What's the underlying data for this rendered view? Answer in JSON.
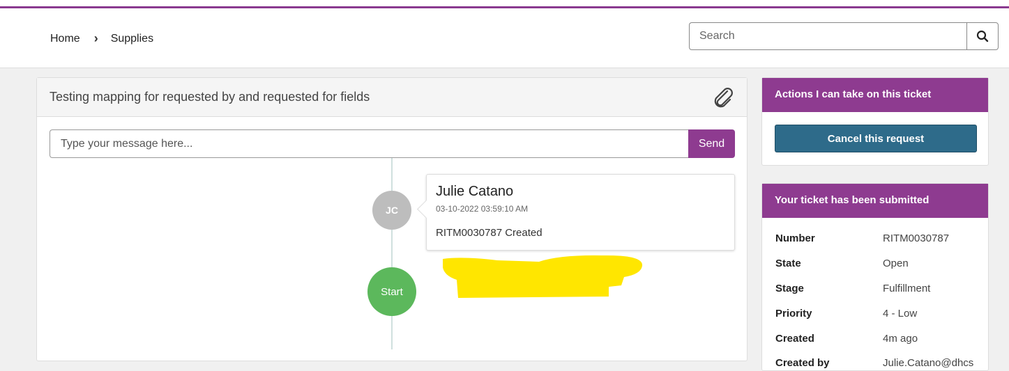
{
  "breadcrumb": {
    "home": "Home",
    "current": "Supplies"
  },
  "search": {
    "placeholder": "Search"
  },
  "ticket_panel": {
    "title": "Testing mapping for requested by and requested for fields",
    "message_placeholder": "Type your message here...",
    "send_label": "Send"
  },
  "activity": {
    "avatar_initials": "JC",
    "author": "Julie Catano",
    "timestamp": "03-10-2022 03:59:10 AM",
    "text": "RITM0030787 Created",
    "start_label": "Start"
  },
  "actions_panel": {
    "title": "Actions I can take on this ticket",
    "cancel_label": "Cancel this request"
  },
  "submitted_panel": {
    "title": "Your ticket has been submitted",
    "fields": [
      {
        "label": "Number",
        "value": "RITM0030787"
      },
      {
        "label": "State",
        "value": "Open"
      },
      {
        "label": "Stage",
        "value": "Fulfillment"
      },
      {
        "label": "Priority",
        "value": "4 - Low"
      },
      {
        "label": "Created",
        "value": "4m ago"
      },
      {
        "label": "Created by",
        "value": "Julie.Catano@dhcs"
      }
    ]
  },
  "colors": {
    "brand": "#8e3b90",
    "button_primary": "#2e6b8a",
    "start_node": "#5cb85c",
    "redaction": "#ffe600"
  }
}
